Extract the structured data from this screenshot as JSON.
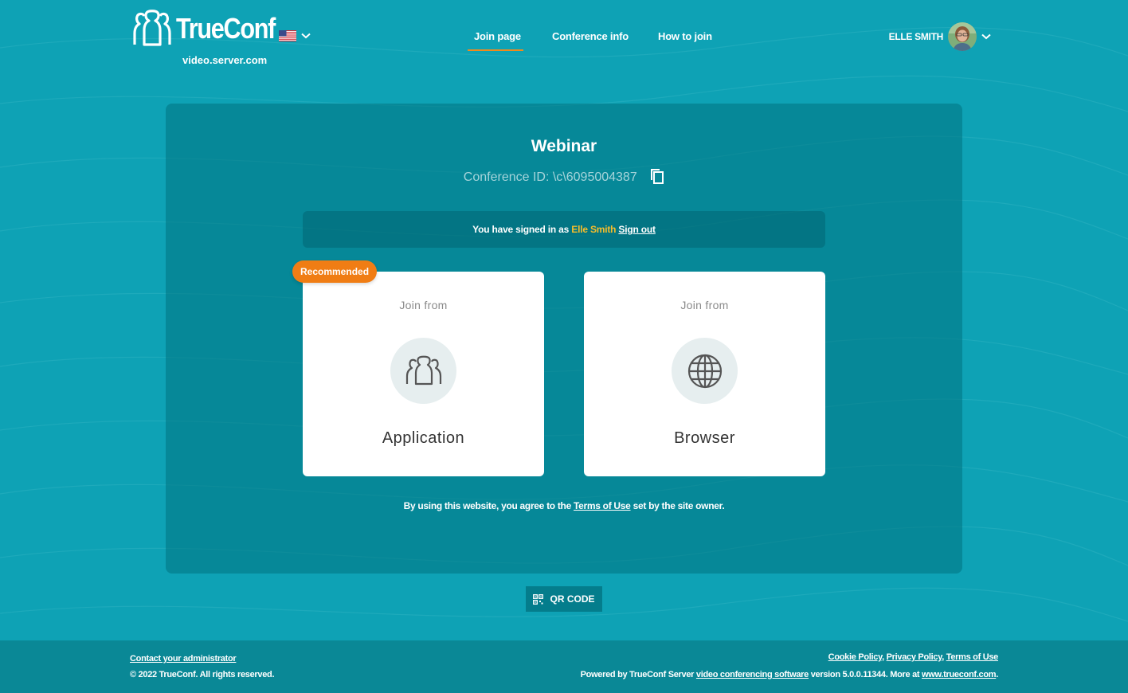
{
  "header": {
    "logo_text": "TrueConf",
    "server": "video.server.com",
    "nav": [
      "Join page",
      "Conference info",
      "How to join"
    ],
    "user_name": "ELLE SMITH"
  },
  "conference": {
    "title": "Webinar",
    "id_label": "Conference ID: \\c\\6095004387"
  },
  "signin": {
    "prefix": "You have signed in as",
    "name": "Elle Smith",
    "signout": "Sign out"
  },
  "badge": "Recommended",
  "cards": [
    {
      "from": "Join from",
      "label": "Application",
      "icon": "users-icon"
    },
    {
      "from": "Join from",
      "label": "Browser",
      "icon": "globe-icon"
    }
  ],
  "terms": {
    "prefix": "By using this website, you agree to the",
    "link": "Terms of Use",
    "suffix": "set by the site owner."
  },
  "qr_label": "QR CODE",
  "footer": {
    "contact": "Contact your administrator",
    "copyright": "© 2022 TrueConf. All rights reserved.",
    "links": [
      "Cookie Policy",
      "Privacy Policy",
      "Terms of Use"
    ],
    "powered_prefix": "Powered by TrueConf Server",
    "powered_link": "video conferencing software",
    "powered_middle": "version 5.0.0.11344. More at",
    "powered_site": "www.trueconf.com"
  },
  "colors": {
    "background": "#0ea2b5",
    "accent_orange": "#f07d14",
    "user_highlight": "#f6bd2b",
    "footer": "#0a8896"
  }
}
